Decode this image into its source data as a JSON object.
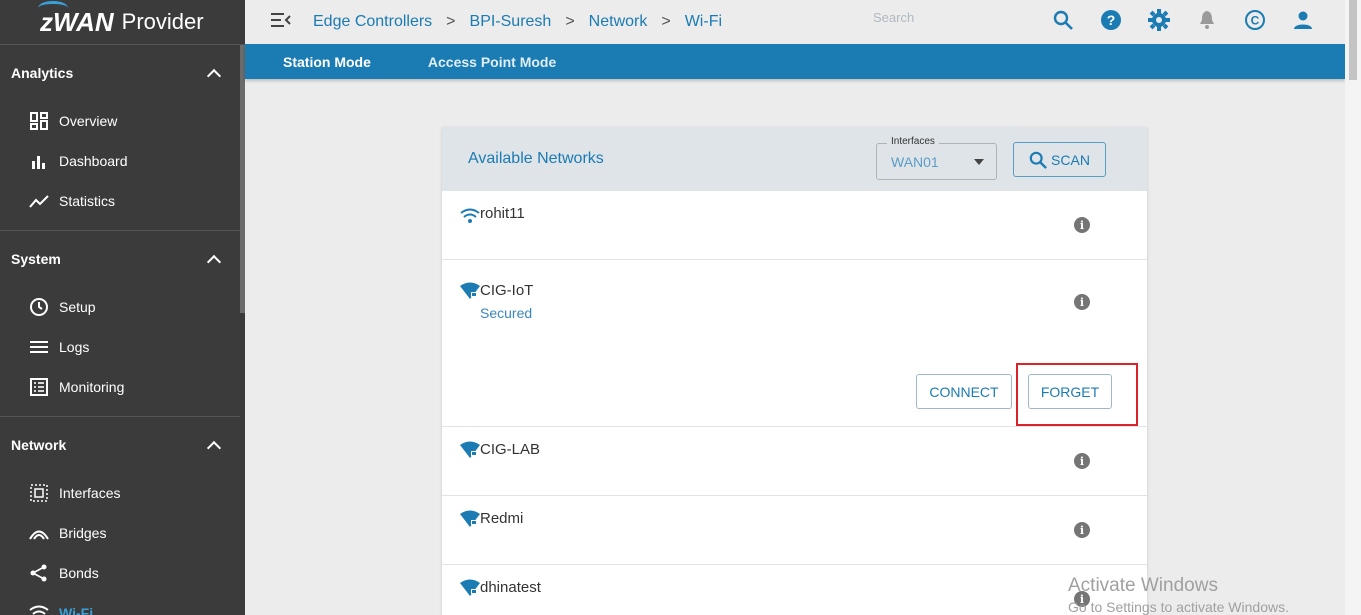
{
  "logo": {
    "brand": "zWAN",
    "product": "Provider"
  },
  "sidebar": {
    "sections": [
      {
        "title": "Analytics",
        "items": [
          {
            "label": "Overview",
            "icon": "overview-icon"
          },
          {
            "label": "Dashboard",
            "icon": "bar-chart-icon"
          },
          {
            "label": "Statistics",
            "icon": "trend-line-icon"
          }
        ]
      },
      {
        "title": "System",
        "items": [
          {
            "label": "Setup",
            "icon": "clock-icon"
          },
          {
            "label": "Logs",
            "icon": "list-icon"
          },
          {
            "label": "Monitoring",
            "icon": "monitoring-icon"
          }
        ]
      },
      {
        "title": "Network",
        "items": [
          {
            "label": "Interfaces",
            "icon": "interfaces-icon"
          },
          {
            "label": "Bridges",
            "icon": "bridge-icon"
          },
          {
            "label": "Bonds",
            "icon": "share-icon"
          },
          {
            "label": "Wi-Fi",
            "icon": "wifi-icon"
          }
        ]
      }
    ]
  },
  "breadcrumb": [
    "Edge Controllers",
    "BPI-Suresh",
    "Network",
    "Wi-Fi"
  ],
  "search": {
    "placeholder": "Search"
  },
  "tabs": [
    "Station Mode",
    "Access Point Mode"
  ],
  "card": {
    "title": "Available Networks",
    "interfaces_label": "Interfaces",
    "interfaces_value": "WAN01",
    "scan_label": "SCAN"
  },
  "networks": [
    {
      "name": "rohit11",
      "status": "",
      "locked": false
    },
    {
      "name": "CIG-IoT",
      "status": "Secured",
      "locked": true,
      "connect_label": "CONNECT",
      "forget_label": "FORGET"
    },
    {
      "name": "CIG-LAB",
      "status": "",
      "locked": true
    },
    {
      "name": "Redmi",
      "status": "",
      "locked": true
    },
    {
      "name": "dhinatest",
      "status": "",
      "locked": true
    }
  ],
  "watermark": {
    "line1": "Activate Windows",
    "line2": "Go to Settings to activate Windows."
  },
  "colors": {
    "accent": "#1b7bb3",
    "sidebar_bg": "#3b3b3b",
    "highlight": "#d9232a"
  }
}
